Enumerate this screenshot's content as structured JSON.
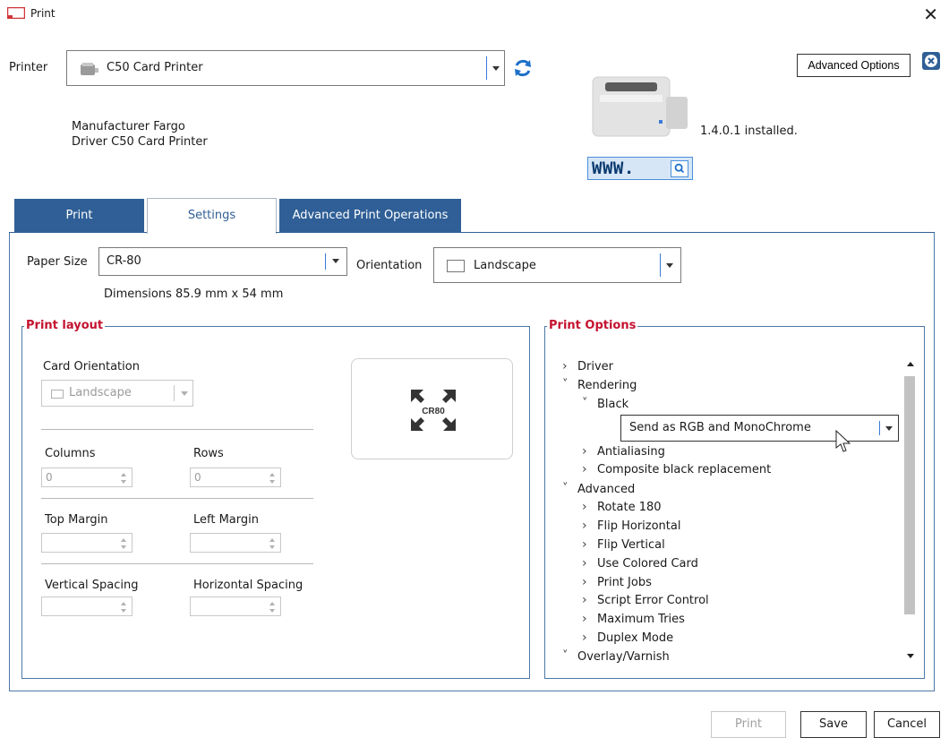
{
  "window": {
    "title": "Print"
  },
  "printer": {
    "label": "Printer",
    "selected": "C50 Card Printer",
    "manufacturer_line": "Manufacturer Fargo",
    "driver_line": "Driver C50 Card Printer",
    "installed_text": "1.4.0.1 installed.",
    "www_text": "WWW."
  },
  "header": {
    "advanced_options_label": "Advanced Options"
  },
  "tabs": [
    {
      "label": "Print",
      "active": false
    },
    {
      "label": "Settings",
      "active": true
    },
    {
      "label": "Advanced Print Operations",
      "active": false
    }
  ],
  "settings": {
    "paper_size_label": "Paper Size",
    "paper_size_value": "CR-80",
    "orientation_label": "Orientation",
    "orientation_value": "Landscape",
    "dimensions_text": "Dimensions 85.9 mm x 54 mm"
  },
  "print_layout": {
    "legend": "Print layout",
    "card_orientation_label": "Card Orientation",
    "card_orientation_value": "Landscape",
    "columns_label": "Columns",
    "columns_value": "0",
    "rows_label": "Rows",
    "rows_value": "0",
    "top_margin_label": "Top Margin",
    "left_margin_label": "Left Margin",
    "vertical_spacing_label": "Vertical Spacing",
    "horizontal_spacing_label": "Horizontal Spacing",
    "preview_text": "CR80"
  },
  "print_options": {
    "legend": "Print Options",
    "tree": [
      {
        "label": "Driver",
        "state": "collapsed",
        "level": 0
      },
      {
        "label": "Rendering",
        "state": "expanded",
        "level": 0
      },
      {
        "label": "Black",
        "state": "expanded",
        "level": 1
      },
      {
        "label": "Antialiasing",
        "state": "collapsed",
        "level": 1
      },
      {
        "label": "Composite black replacement",
        "state": "collapsed",
        "level": 1
      },
      {
        "label": "Advanced",
        "state": "expanded",
        "level": 0
      },
      {
        "label": "Rotate 180",
        "state": "collapsed",
        "level": 1
      },
      {
        "label": "Flip Horizontal",
        "state": "collapsed",
        "level": 1
      },
      {
        "label": "Flip Vertical",
        "state": "collapsed",
        "level": 1
      },
      {
        "label": "Use Colored Card",
        "state": "collapsed",
        "level": 1
      },
      {
        "label": "Print Jobs",
        "state": "collapsed",
        "level": 1
      },
      {
        "label": "Script Error Control",
        "state": "collapsed",
        "level": 1
      },
      {
        "label": "Maximum Tries",
        "state": "collapsed",
        "level": 1
      },
      {
        "label": "Duplex Mode",
        "state": "collapsed",
        "level": 1
      },
      {
        "label": "Overlay/Varnish",
        "state": "expanded",
        "level": 0
      }
    ],
    "black_value": "Send as RGB and MonoChrome"
  },
  "footer": {
    "print_label": "Print",
    "save_label": "Save",
    "cancel_label": "Cancel"
  },
  "colors": {
    "tab_blue": "#2f5f96",
    "legend_red": "#c4122f",
    "accent_blue": "#3a7bd5"
  }
}
